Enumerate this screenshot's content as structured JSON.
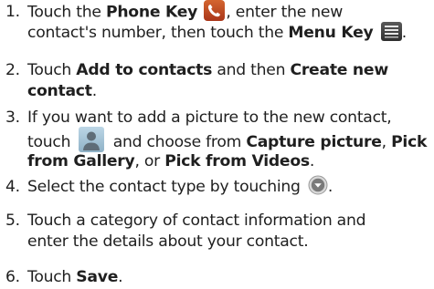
{
  "steps": [
    {
      "number": "1.",
      "line1": {
        "t1": "Touch the ",
        "b1": "Phone Key",
        "t2": ", enter the new"
      },
      "line2": {
        "t1": "contact's number, then touch the ",
        "b1": "Menu Key",
        "t2": "."
      }
    },
    {
      "number": "2.",
      "line1": {
        "t1": "Touch ",
        "b1": "Add to contacts",
        "t2": " and then ",
        "b2": "Create new"
      },
      "line2": {
        "b1": "contact",
        "t1": "."
      }
    },
    {
      "number": "3.",
      "line1": {
        "t1": "If you want to add a picture to the new contact,"
      },
      "line2": {
        "t1": "touch ",
        "t2": " and choose from ",
        "b1": "Capture picture",
        "t3": ", ",
        "b2": "Pick"
      },
      "line3": {
        "b1": "from Gallery",
        "t1": ", or ",
        "b2": "Pick from Videos",
        "t2": "."
      }
    },
    {
      "number": "4.",
      "line1": {
        "t1": "Select the contact type by touching ",
        "t2": "."
      }
    },
    {
      "number": "5.",
      "line1": {
        "t1": "Touch a category of contact information and"
      },
      "line2": {
        "t1": "enter the details about your contact."
      }
    },
    {
      "number": "6.",
      "line1": {
        "t1": "Touch ",
        "b1": "Save",
        "t2": "."
      }
    }
  ],
  "icons": {
    "phone": "phone-key-icon",
    "menu": "menu-key-icon",
    "contact_picture": "contact-picture-icon",
    "contact_type": "contact-type-dropdown-icon"
  },
  "colors": {
    "text": "#1f1f1f",
    "phone_icon": "#c04a24",
    "menu_icon": "#3c3c3c",
    "contact_icon": "#a7c3d6",
    "type_icon": "#7a7a7a"
  }
}
